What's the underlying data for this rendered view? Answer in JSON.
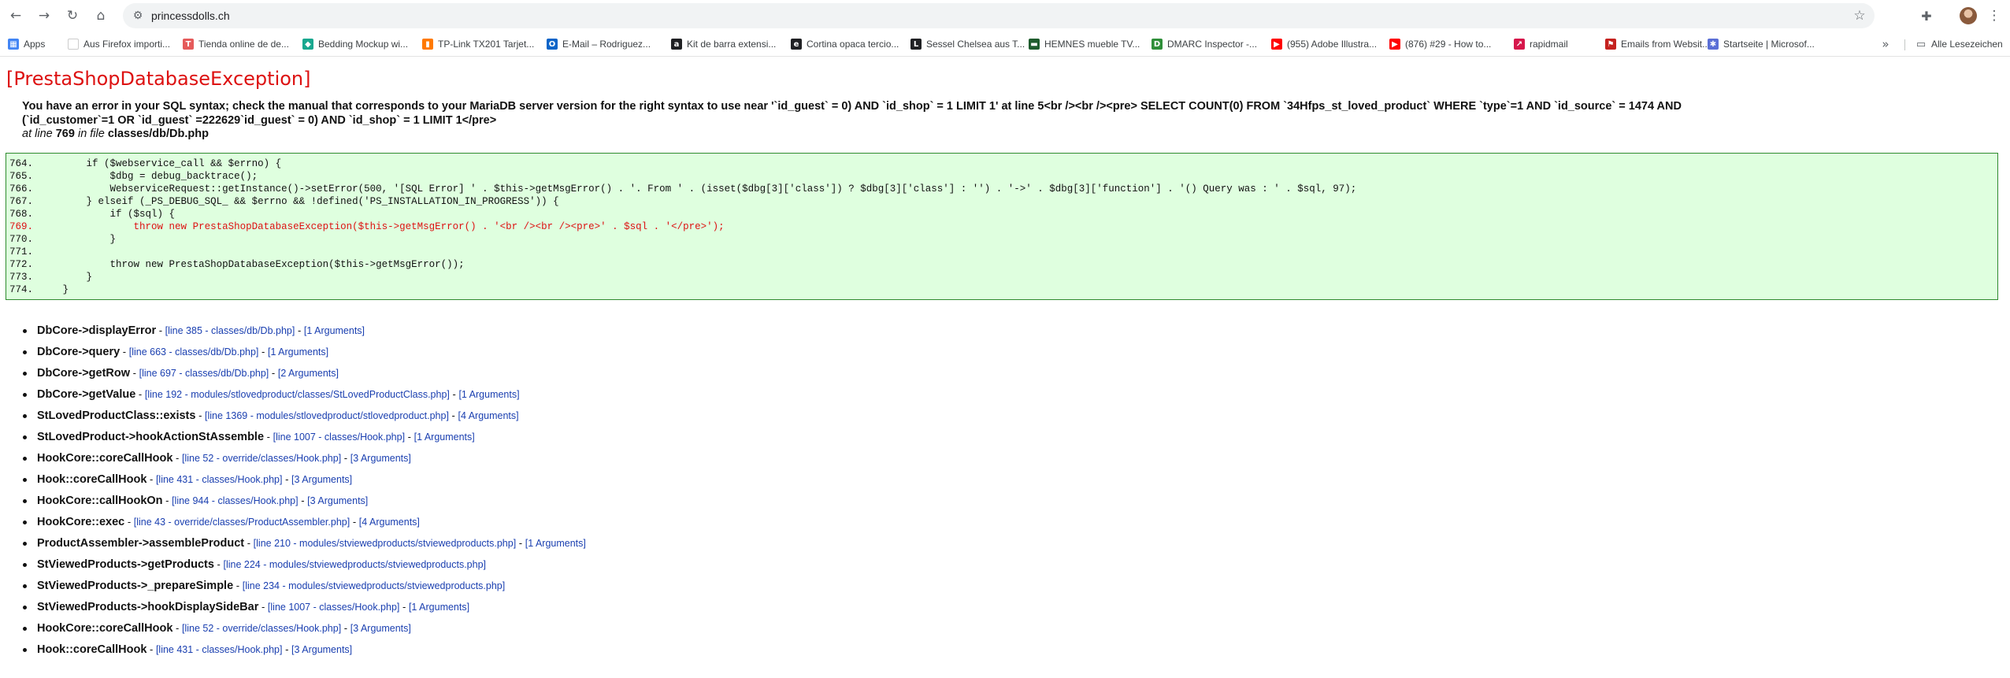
{
  "browser": {
    "url": "princessdolls.ch",
    "bookmarks": [
      {
        "label": "Apps",
        "color": "#4285f4",
        "glyph": "▦"
      },
      {
        "label": "Aus Firefox importi...",
        "color": "#ffffff",
        "glyph": ""
      },
      {
        "label": "Tienda online de de...",
        "color": "#e55b5b",
        "glyph": "T"
      },
      {
        "label": "Bedding Mockup wi...",
        "color": "#19a88f",
        "glyph": "◆"
      },
      {
        "label": "TP-Link TX201 Tarjet...",
        "color": "#ff7a00",
        "glyph": "▮"
      },
      {
        "label": "E-Mail – Rodriguez...",
        "color": "#0a64c8",
        "glyph": "O"
      },
      {
        "label": "Kit de barra extensi...",
        "color": "#202124",
        "glyph": "a"
      },
      {
        "label": "Cortina opaca tercio...",
        "color": "#202124",
        "glyph": "e"
      },
      {
        "label": "Sessel Chelsea aus T...",
        "color": "#202124",
        "glyph": "L"
      },
      {
        "label": "HEMNES mueble TV...",
        "color": "#1f5c2e",
        "glyph": "▬"
      },
      {
        "label": "DMARC Inspector -...",
        "color": "#2f8f3a",
        "glyph": "D"
      },
      {
        "label": "(955) Adobe Illustra...",
        "color": "#ff0000",
        "glyph": "▶"
      },
      {
        "label": "(876) #29 - How to...",
        "color": "#ff0000",
        "glyph": "▶"
      },
      {
        "label": "rapidmail",
        "color": "#d6174b",
        "glyph": "↗"
      },
      {
        "label": "Emails from Websit...",
        "color": "#c5221f",
        "glyph": "⚑"
      },
      {
        "label": "Startseite | Microsof...",
        "color": "#5b6fd6",
        "glyph": "✱"
      }
    ],
    "all_bookmarks_label": "Alle Lesezeichen"
  },
  "error": {
    "title": "[PrestaShopDatabaseException]",
    "message_line1": "You have an error in your SQL syntax; check the manual that corresponds to your MariaDB server version for the right syntax to use near '`id_guest` = 0) AND `id_shop` = 1 LIMIT 1' at line 5<br /><br /><pre> SELECT COUNT(0) FROM `34Hfps_st_loved_product` WHERE `type`=1 AND `id_source` = 1474 AND",
    "message_line2": "(`id_customer`=1 OR `id_guest` =222629`id_guest` = 0) AND `id_shop` = 1 LIMIT 1</pre>",
    "at_line_label": "at line",
    "line_number": "769",
    "in_file_label": "in file",
    "file": "classes/db/Db.php"
  },
  "code": [
    {
      "num": "764.",
      "text": "        if ($webservice_call && $errno) {"
    },
    {
      "num": "765.",
      "text": "            $dbg = debug_backtrace();"
    },
    {
      "num": "766.",
      "text": "            WebserviceRequest::getInstance()->setError(500, '[SQL Error] ' . $this->getMsgError() . '. From ' . (isset($dbg[3]['class']) ? $dbg[3]['class'] : '') . '->' . $dbg[3]['function'] . '() Query was : ' . $sql, 97);"
    },
    {
      "num": "767.",
      "text": "        } elseif (_PS_DEBUG_SQL_ && $errno && !defined('PS_INSTALLATION_IN_PROGRESS')) {"
    },
    {
      "num": "768.",
      "text": "            if ($sql) {"
    },
    {
      "num": "769.",
      "text": "                throw new PrestaShopDatabaseException($this->getMsgError() . '<br /><br /><pre>' . $sql . '</pre>');"
    },
    {
      "num": "770.",
      "text": "            }"
    },
    {
      "num": "771.",
      "text": ""
    },
    {
      "num": "772.",
      "text": "            throw new PrestaShopDatabaseException($this->getMsgError());"
    },
    {
      "num": "773.",
      "text": "        }"
    },
    {
      "num": "774.",
      "text": "    }"
    }
  ],
  "highlight_line": "769.",
  "stack": [
    {
      "fn": "DbCore->displayError",
      "loc": "[line 385 - classes/db/Db.php]",
      "args": "[1 Arguments]"
    },
    {
      "fn": "DbCore->query",
      "loc": "[line 663 - classes/db/Db.php]",
      "args": "[1 Arguments]"
    },
    {
      "fn": "DbCore->getRow",
      "loc": "[line 697 - classes/db/Db.php]",
      "args": "[2 Arguments]"
    },
    {
      "fn": "DbCore->getValue",
      "loc": "[line 192 - modules/stlovedproduct/classes/StLovedProductClass.php]",
      "args": "[1 Arguments]"
    },
    {
      "fn": "StLovedProductClass::exists",
      "loc": "[line 1369 - modules/stlovedproduct/stlovedproduct.php]",
      "args": "[4 Arguments]"
    },
    {
      "fn": "StLovedProduct->hookActionStAssemble",
      "loc": "[line 1007 - classes/Hook.php]",
      "args": "[1 Arguments]"
    },
    {
      "fn": "HookCore::coreCallHook",
      "loc": "[line 52 - override/classes/Hook.php]",
      "args": "[3 Arguments]"
    },
    {
      "fn": "Hook::coreCallHook",
      "loc": "[line 431 - classes/Hook.php]",
      "args": "[3 Arguments]"
    },
    {
      "fn": "HookCore::callHookOn",
      "loc": "[line 944 - classes/Hook.php]",
      "args": "[3 Arguments]"
    },
    {
      "fn": "HookCore::exec",
      "loc": "[line 43 - override/classes/ProductAssembler.php]",
      "args": "[4 Arguments]"
    },
    {
      "fn": "ProductAssembler->assembleProduct",
      "loc": "[line 210 - modules/stviewedproducts/stviewedproducts.php]",
      "args": "[1 Arguments]"
    },
    {
      "fn": "StViewedProducts->getProducts",
      "loc": "[line 224 - modules/stviewedproducts/stviewedproducts.php]",
      "args": ""
    },
    {
      "fn": "StViewedProducts->_prepareSimple",
      "loc": "[line 234 - modules/stviewedproducts/stviewedproducts.php]",
      "args": ""
    },
    {
      "fn": "StViewedProducts->hookDisplaySideBar",
      "loc": "[line 1007 - classes/Hook.php]",
      "args": "[1 Arguments]"
    },
    {
      "fn": "HookCore::coreCallHook",
      "loc": "[line 52 - override/classes/Hook.php]",
      "args": "[3 Arguments]"
    },
    {
      "fn": "Hook::coreCallHook",
      "loc": "[line 431 - classes/Hook.php]",
      "args": "[3 Arguments]"
    }
  ]
}
